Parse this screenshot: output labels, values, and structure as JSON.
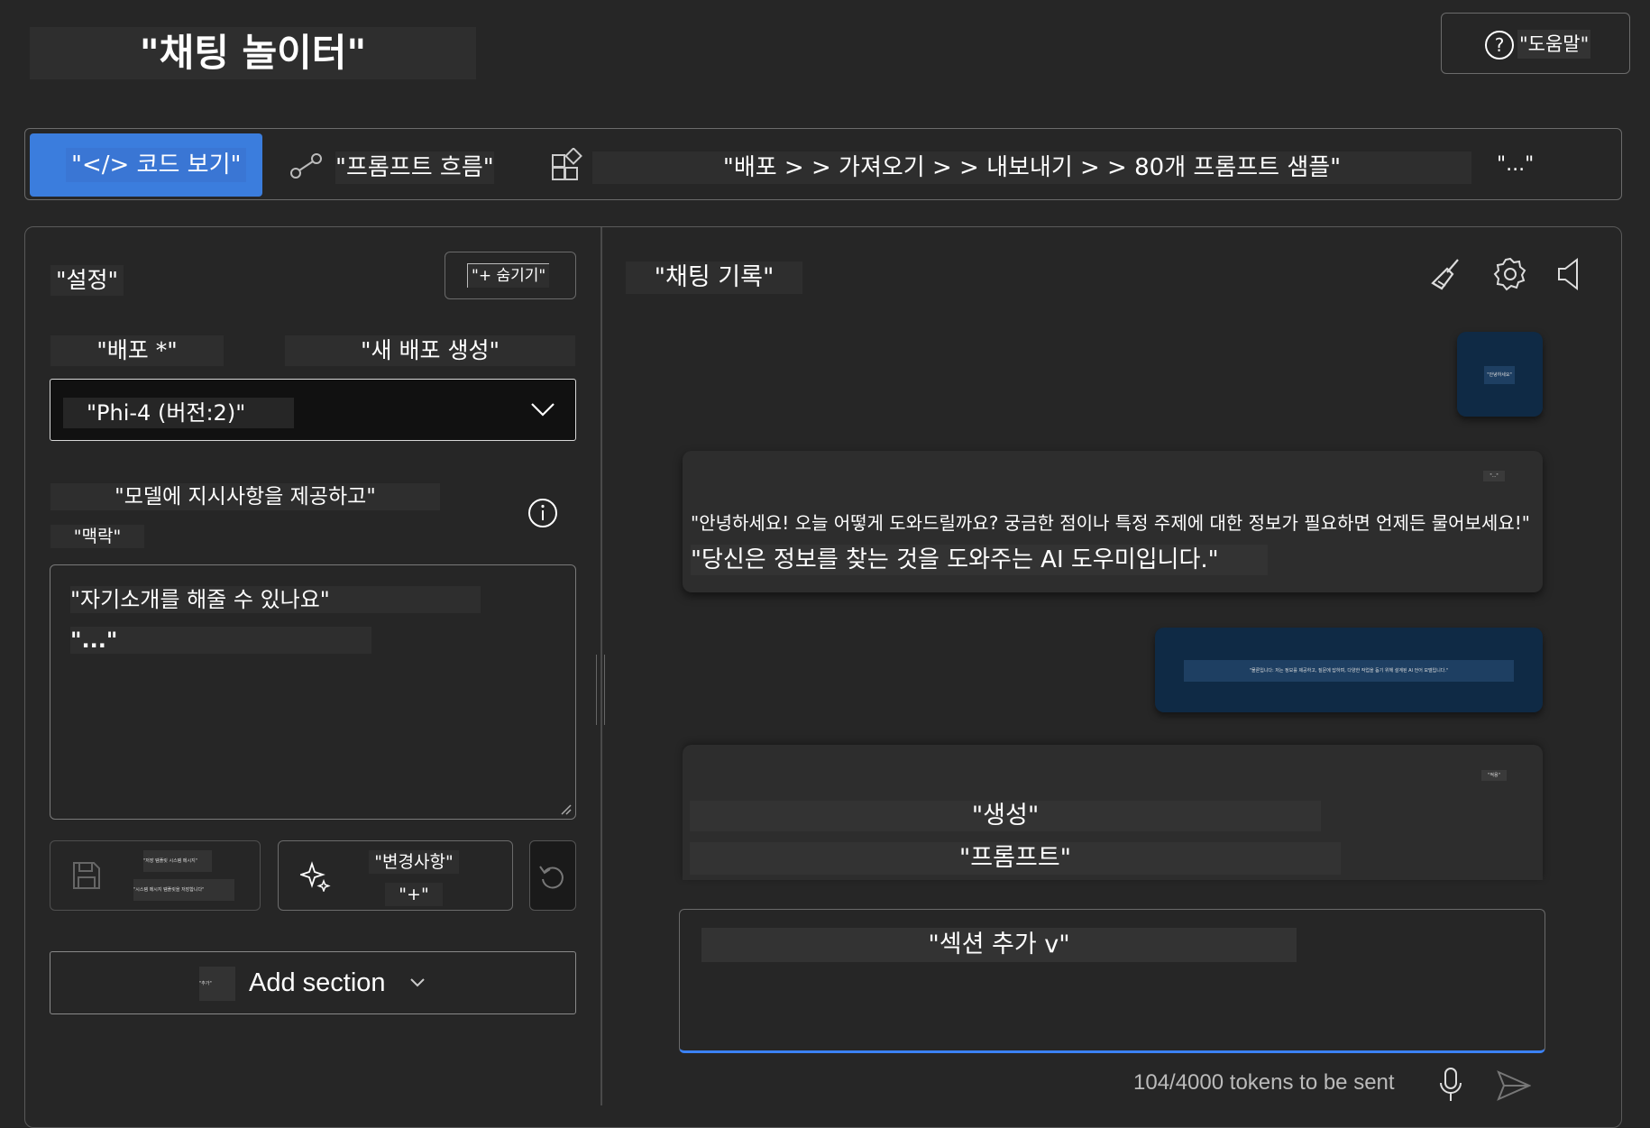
{
  "header": {
    "title": "\"채팅 놀이터\"",
    "help_label": "\"도움말\""
  },
  "toolbar": {
    "code_view": "\"</> 코드 보기\"",
    "prompt_flow": "\"프롬프트 흐름\"",
    "breadcrumb": "\"배포 > > 가져오기 > > 내보내기 > > 80개 프롬프트 샘플\"",
    "more": "\"...\""
  },
  "settings": {
    "title": "\"설정\"",
    "hide_label": "\"+ 숨기기\"",
    "deployment_label": "\"배포 *\"",
    "new_deployment": "\"새 배포 생성\"",
    "deployment_value": "\"Phi-4 (버전:2)\"",
    "instructions_line1": "\"모델에 지시사항을 제공하고\"",
    "instructions_line2": "\"맥락\"",
    "system_text_line1": "\"자기소개를 해줄 수 있나요\"",
    "system_text_line2": "\"...\"",
    "save_line1": "\"저장 템플릿 시스템 메시지\"",
    "save_line2": "\"시스템 메시지 템플릿을 저장합니다\"",
    "changes_line1": "\"변경사항\"",
    "changes_line2": "\"+\"",
    "add_section_prefix": "\"추가\"",
    "add_section": "Add section"
  },
  "chat": {
    "title": "\"채팅 기록\"",
    "user_bubble_1": "\"안녕하세요\"",
    "assistant_1_menu": "\"...\"",
    "assistant_1_line1": "\"안녕하세요! 오늘 어떻게 도와드릴까요? 궁금한 점이나 특정 주제에 대한 정보가 필요하면 언제든 물어보세요!\"",
    "assistant_1_line2": "\"당신은 정보를 찾는 것을 도와주는 AI 도우미입니다.\"",
    "user_bubble_2": "\"물론입니다: 저는 정보를 제공하고, 질문에 답하며, 다양한 작업을 돕기 위해 설계된 AI 언어 모델입니다.\"",
    "assistant_2_tag": "\"적용\"",
    "assistant_2_line1": "\"생성\"",
    "assistant_2_line2": "\"프롬프트\"",
    "input_text": "\"섹션 추가 v\"",
    "token_count": "104/4000 tokens to be sent"
  },
  "colors": {
    "accent": "#3b82f6",
    "user_bubble": "#0f2a45",
    "panel_bg": "#262626",
    "border": "#5a5a5a"
  },
  "icons": [
    "help-icon",
    "prompt-flow-icon",
    "apps-icon",
    "clear-chat-icon",
    "settings-icon",
    "speaker-icon",
    "chevron-down-icon",
    "info-icon",
    "save-icon",
    "sparkle-icon",
    "undo-icon",
    "microphone-icon",
    "send-icon"
  ]
}
